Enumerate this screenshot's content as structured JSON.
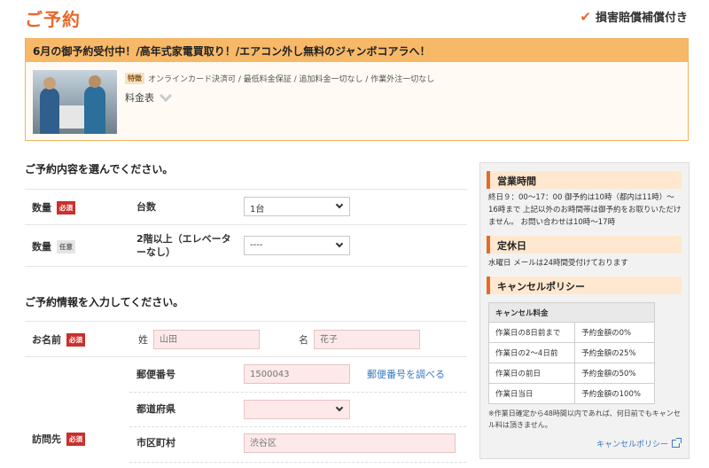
{
  "header": {
    "title": "ご予約",
    "insurance_label": "損害賠償補償付き",
    "check_icon": "check-icon"
  },
  "promo": {
    "headline": "6月の御予約受付中！/高年式家電買取り！/エアコン外し無料のジャンボコアラへ！",
    "feature_badge": "特徴",
    "features_text": "オンラインカード決済可 / 最低料金保証 / 追加料金一切なし / 作業外注一切なし",
    "price_label": "料金表"
  },
  "form": {
    "section1_title": "ご予約内容を選んでください。",
    "section2_title": "ご予約情報を入力してください。",
    "required_badge": "必須",
    "optional_badge": "任意",
    "rows": {
      "quantity1": {
        "label": "数量",
        "sublabel": "台数",
        "selected": "1台"
      },
      "quantity2": {
        "label": "数量",
        "sublabel": "2階以上（エレベーターなし）",
        "selected": "----"
      },
      "name": {
        "label": "お名前",
        "sei_label": "姓",
        "sei_placeholder": "山田",
        "mei_label": "名",
        "mei_placeholder": "花子"
      },
      "visit": {
        "label": "訪問先",
        "zip_label": "郵便番号",
        "zip_placeholder": "1500043",
        "zip_link": "郵便番号を調べる",
        "pref_label": "都道府県",
        "pref_selected": "",
        "city_label": "市区町村",
        "city_placeholder": "渋谷区"
      }
    }
  },
  "sidebar": {
    "hours_title": "営業時間",
    "hours_text": "終日９：00～17：00 御予約は10時（都内は11時）～16時まで 上記以外のお時間帯は御予約をお取りいただけません。 お問い合わせは10時～17時",
    "holiday_title": "定休日",
    "holiday_text": "水曜日 メールは24時間受付けております",
    "cancel_title": "キャンセルポリシー",
    "cancel_table_header": "キャンセル料金",
    "cancel_rows": [
      {
        "when": "作業日の8日前まで",
        "fee": "予約金額の0%"
      },
      {
        "when": "作業日の2～4日前",
        "fee": "予約金額の25%"
      },
      {
        "when": "作業日の前日",
        "fee": "予約金額の50%"
      },
      {
        "when": "作業日当日",
        "fee": "予約金額の100%"
      }
    ],
    "note": "※作業日確定から48時間以内であれば、何日前でもキャンセル料は頂きません。",
    "policy_link": "キャンセルポリシー"
  }
}
